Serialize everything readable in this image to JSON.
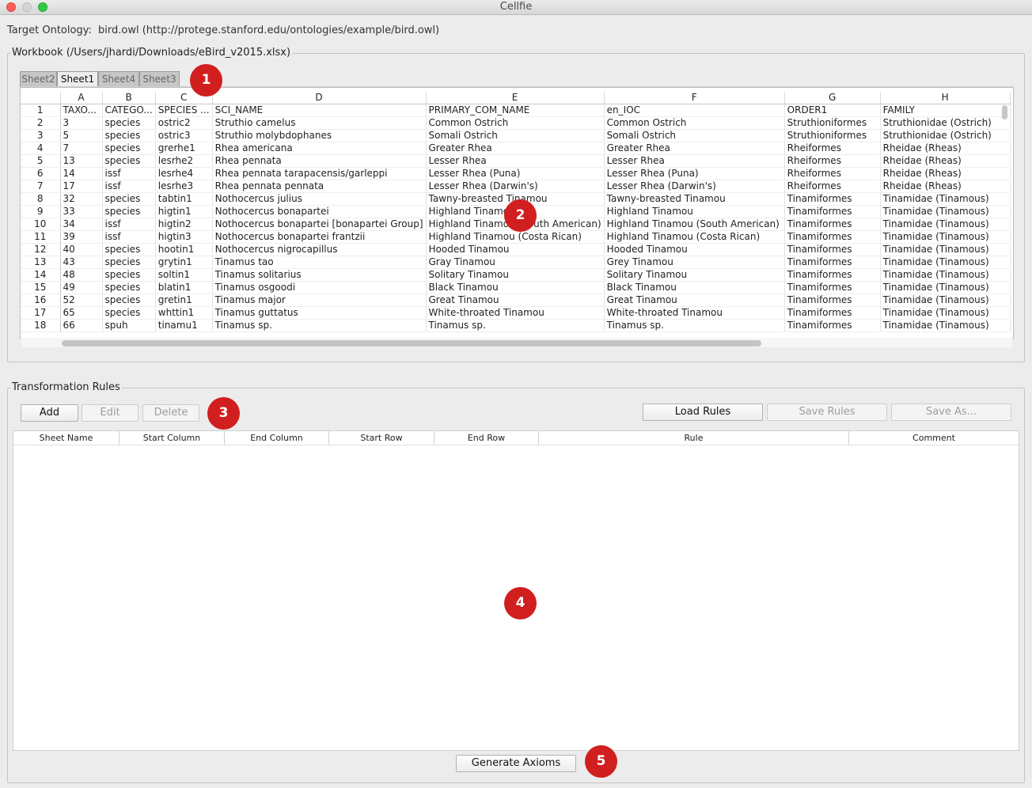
{
  "window": {
    "title": "Cellfie"
  },
  "target": {
    "label": "Target Ontology:",
    "value": "bird.owl (http://protege.stanford.edu/ontologies/example/bird.owl)"
  },
  "workbook": {
    "title": "Workbook (/Users/jhardi/Downloads/eBird_v2015.xlsx)",
    "tabs": [
      {
        "label": "Sheet2",
        "active": false
      },
      {
        "label": "Sheet1",
        "active": true
      },
      {
        "label": "Sheet4",
        "active": false
      },
      {
        "label": "Sheet3",
        "active": false
      }
    ],
    "columns": [
      "A",
      "B",
      "C",
      "D",
      "E",
      "F",
      "G",
      "H"
    ],
    "rows": [
      [
        "1",
        "TAXO...",
        "CATEGO...",
        "SPECIES ...",
        "SCI_NAME",
        "PRIMARY_COM_NAME",
        "en_IOC",
        "ORDER1",
        "FAMILY"
      ],
      [
        "2",
        "3",
        "species",
        "ostric2",
        "Struthio camelus",
        "Common Ostrich",
        "Common Ostrich",
        "Struthioniformes",
        "Struthionidae (Ostrich)"
      ],
      [
        "3",
        "5",
        "species",
        "ostric3",
        "Struthio molybdophanes",
        "Somali Ostrich",
        "Somali Ostrich",
        "Struthioniformes",
        "Struthionidae (Ostrich)"
      ],
      [
        "4",
        "7",
        "species",
        "grerhe1",
        "Rhea americana",
        "Greater Rhea",
        "Greater Rhea",
        "Rheiformes",
        "Rheidae (Rheas)"
      ],
      [
        "5",
        "13",
        "species",
        "lesrhe2",
        "Rhea pennata",
        "Lesser Rhea",
        "Lesser Rhea",
        "Rheiformes",
        "Rheidae (Rheas)"
      ],
      [
        "6",
        "14",
        "issf",
        "lesrhe4",
        "Rhea pennata tarapacensis/garleppi",
        "Lesser Rhea (Puna)",
        "Lesser Rhea (Puna)",
        "Rheiformes",
        "Rheidae (Rheas)"
      ],
      [
        "7",
        "17",
        "issf",
        "lesrhe3",
        "Rhea pennata pennata",
        "Lesser Rhea (Darwin's)",
        "Lesser Rhea (Darwin's)",
        "Rheiformes",
        "Rheidae (Rheas)"
      ],
      [
        "8",
        "32",
        "species",
        "tabtin1",
        "Nothocercus julius",
        "Tawny-breasted Tinamou",
        "Tawny-breasted Tinamou",
        "Tinamiformes",
        "Tinamidae (Tinamous)"
      ],
      [
        "9",
        "33",
        "species",
        "higtin1",
        "Nothocercus bonapartei",
        "Highland Tinamou",
        "Highland Tinamou",
        "Tinamiformes",
        "Tinamidae (Tinamous)"
      ],
      [
        "10",
        "34",
        "issf",
        "higtin2",
        "Nothocercus bonapartei [bonapartei Group]",
        "Highland Tinamou (South American)",
        "Highland Tinamou (South American)",
        "Tinamiformes",
        "Tinamidae (Tinamous)"
      ],
      [
        "11",
        "39",
        "issf",
        "higtin3",
        "Nothocercus bonapartei frantzii",
        "Highland Tinamou (Costa Rican)",
        "Highland Tinamou (Costa Rican)",
        "Tinamiformes",
        "Tinamidae (Tinamous)"
      ],
      [
        "12",
        "40",
        "species",
        "hootin1",
        "Nothocercus nigrocapillus",
        "Hooded Tinamou",
        "Hooded Tinamou",
        "Tinamiformes",
        "Tinamidae (Tinamous)"
      ],
      [
        "13",
        "43",
        "species",
        "grytin1",
        "Tinamus tao",
        "Gray Tinamou",
        "Grey Tinamou",
        "Tinamiformes",
        "Tinamidae (Tinamous)"
      ],
      [
        "14",
        "48",
        "species",
        "soltin1",
        "Tinamus solitarius",
        "Solitary Tinamou",
        "Solitary Tinamou",
        "Tinamiformes",
        "Tinamidae (Tinamous)"
      ],
      [
        "15",
        "49",
        "species",
        "blatin1",
        "Tinamus osgoodi",
        "Black Tinamou",
        "Black Tinamou",
        "Tinamiformes",
        "Tinamidae (Tinamous)"
      ],
      [
        "16",
        "52",
        "species",
        "gretin1",
        "Tinamus major",
        "Great Tinamou",
        "Great Tinamou",
        "Tinamiformes",
        "Tinamidae (Tinamous)"
      ],
      [
        "17",
        "65",
        "species",
        "whttin1",
        "Tinamus guttatus",
        "White-throated Tinamou",
        "White-throated Tinamou",
        "Tinamiformes",
        "Tinamidae (Tinamous)"
      ],
      [
        "18",
        "66",
        "spuh",
        "tinamu1",
        "Tinamus sp.",
        "Tinamus sp.",
        "Tinamus sp.",
        "Tinamiformes",
        "Tinamidae (Tinamous)"
      ]
    ]
  },
  "rules": {
    "title": "Transformation Rules",
    "buttons": {
      "add": "Add",
      "edit": "Edit",
      "delete": "Delete",
      "load": "Load Rules",
      "save": "Save Rules",
      "save_as": "Save As..."
    },
    "columns": [
      "Sheet Name",
      "Start Column",
      "End Column",
      "Start Row",
      "End Row",
      "Rule",
      "Comment"
    ]
  },
  "generate_label": "Generate Axioms",
  "callouts": [
    "1",
    "2",
    "3",
    "4",
    "5"
  ]
}
